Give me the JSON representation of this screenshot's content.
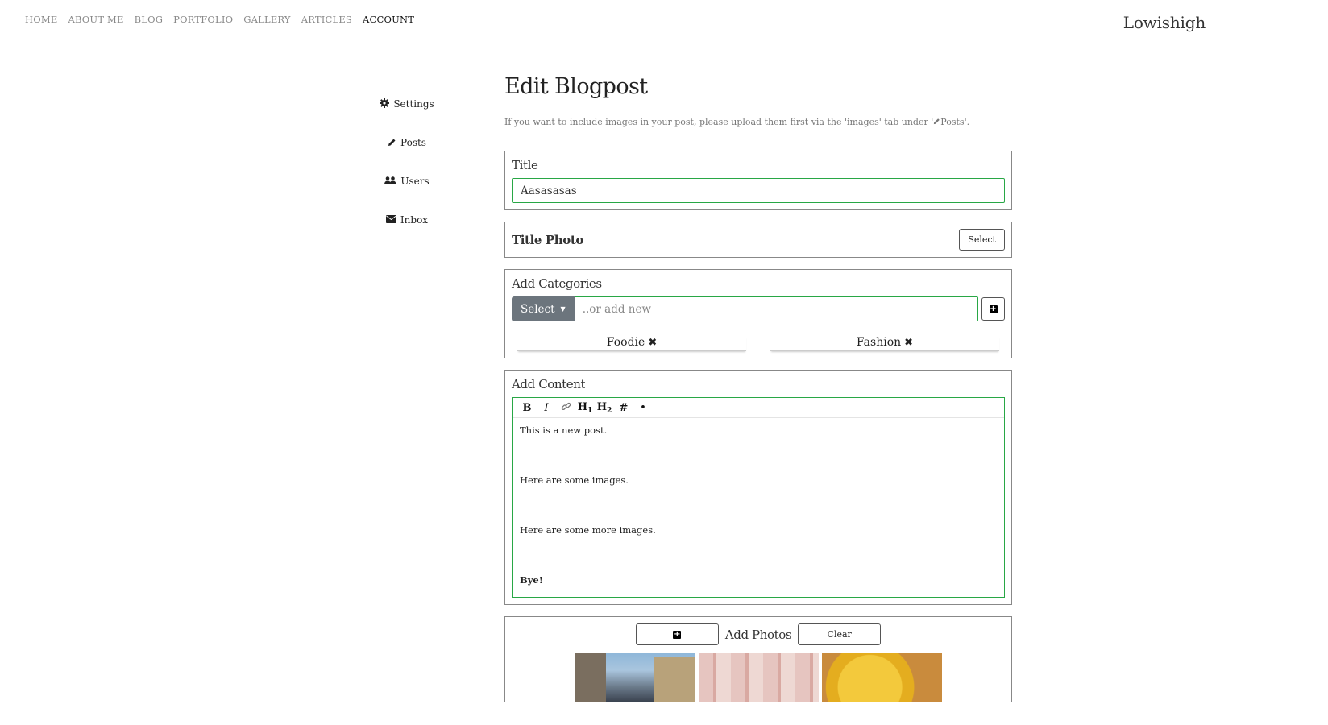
{
  "nav": {
    "items": [
      "HOME",
      "ABOUT ME",
      "BLOG",
      "PORTFOLIO",
      "GALLERY",
      "ARTICLES",
      "ACCOUNT"
    ],
    "active": "ACCOUNT"
  },
  "brand": "Lowishigh",
  "sidebar": {
    "items": [
      {
        "label": "Settings",
        "icon": "gear-icon"
      },
      {
        "label": "Posts",
        "icon": "pencil-icon"
      },
      {
        "label": "Users",
        "icon": "users-icon"
      },
      {
        "label": "Inbox",
        "icon": "envelope-icon"
      }
    ]
  },
  "page": {
    "title": "Edit Blogpost",
    "hint_before": "If you want to include images in your post, please upload them first via the 'images' tab under '",
    "hint_link": "Posts",
    "hint_after": "'."
  },
  "title_card": {
    "label": "Title",
    "value": "Aasasasas"
  },
  "title_photo": {
    "label": "Title Photo",
    "button": "Select"
  },
  "categories": {
    "label": "Add Categories",
    "dropdown": "Select",
    "placeholder": "..or add new",
    "tags": [
      "Foodie",
      "Fashion"
    ]
  },
  "content": {
    "label": "Add Content",
    "toolbar": {
      "bold": "B",
      "italic": "I",
      "h1": "H",
      "h1_sub": "1",
      "h2": "H",
      "h2_sub": "2",
      "hash": "#",
      "bullet": "•"
    },
    "paragraphs": [
      "This is a new post.",
      "Here are some images.",
      "Here are some more images.",
      "Bye!"
    ]
  },
  "photos": {
    "label": "Add Photos",
    "clear": "Clear"
  }
}
